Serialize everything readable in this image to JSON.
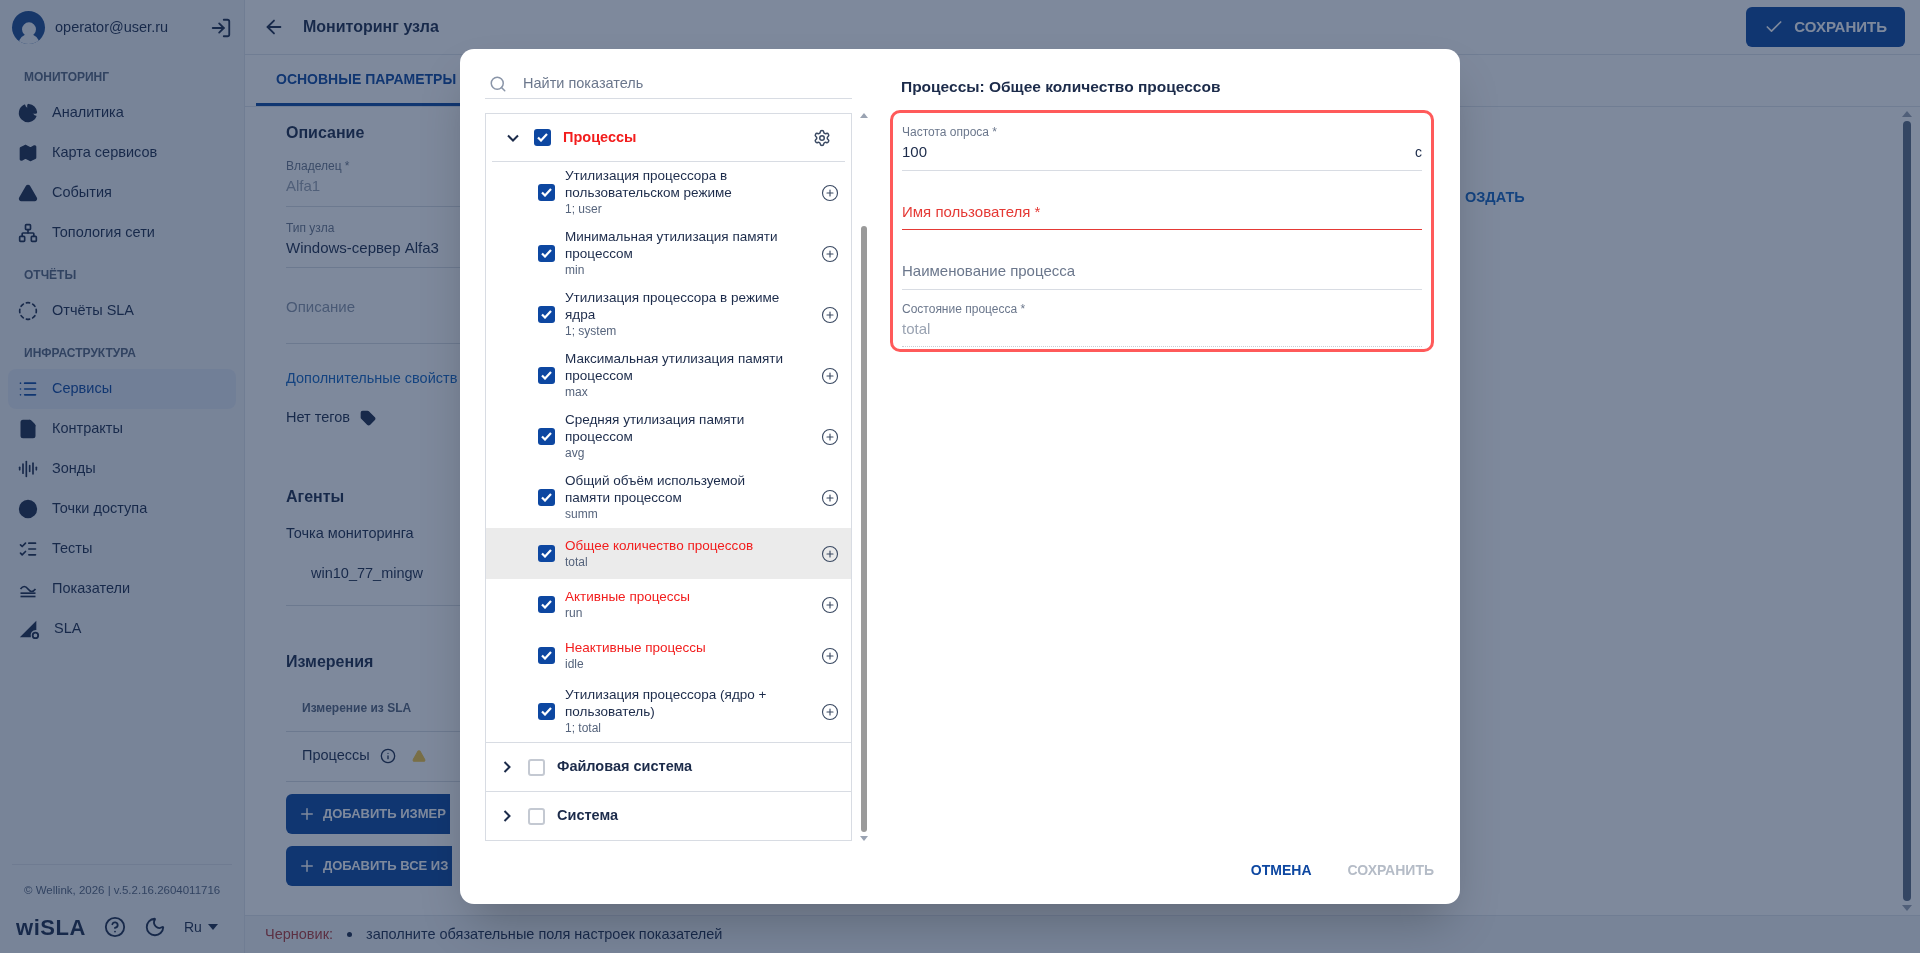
{
  "sidebar": {
    "user": "operator@user.ru",
    "sections": [
      {
        "title": "МОНИТОРИНГ",
        "items": [
          {
            "label": "Аналитика",
            "selected": false
          },
          {
            "label": "Карта сервисов",
            "selected": false
          },
          {
            "label": "События",
            "selected": false
          },
          {
            "label": "Топология сети",
            "selected": false
          }
        ]
      },
      {
        "title": "ОТЧЁТЫ",
        "items": [
          {
            "label": "Отчёты SLA",
            "selected": false
          }
        ]
      },
      {
        "title": "ИНФРАСТРУКТУРА",
        "items": [
          {
            "label": "Сервисы",
            "selected": true
          },
          {
            "label": "Контракты",
            "selected": false
          },
          {
            "label": "Зонды",
            "selected": false
          },
          {
            "label": "Точки доступа",
            "selected": false
          },
          {
            "label": "Тесты",
            "selected": false
          },
          {
            "label": "Показатели",
            "selected": false
          },
          {
            "label": "SLA",
            "selected": false
          }
        ]
      }
    ],
    "copyright": "© Wellink, 2026 | v.5.2.16.2604011716",
    "logo": "wiSLA",
    "language": "Ru"
  },
  "header": {
    "title": "Мониторинг узла",
    "save_button": "СОХРАНИТЬ"
  },
  "tabs": [
    {
      "label": "ОСНОВНЫЕ ПАРАМЕТРЫ",
      "selected": true
    }
  ],
  "description": {
    "heading": "Описание",
    "fields": [
      {
        "label": "Владелец *",
        "value": "Alfa1",
        "disabled": true
      },
      {
        "label": "Тип узла",
        "value": "Windows-сервер Alfa3",
        "disabled": false
      },
      {
        "placeholder": "Описание",
        "disabled": false
      }
    ],
    "more_link": "Дополнительные свойств",
    "tags": "Нет тегов"
  },
  "agents": {
    "heading": "Агенты",
    "label": "Точка мониторинга",
    "value": "win10_77_mingw"
  },
  "measurements": {
    "heading": "Измерения",
    "column_1": "Измерение из SLA",
    "rows": [
      {
        "name": "Процессы"
      }
    ],
    "buttons": [
      "ДОБАВИТЬ ИЗМЕР",
      "ДОБАВИТЬ ВСЕ ИЗ"
    ]
  },
  "side_action": "ОЗДАТЬ",
  "status_bar": {
    "label": "Черновик:",
    "messages": [
      "заполните обязательные поля настроек показателей"
    ]
  },
  "dialog": {
    "search": {
      "placeholder": "Найти показатель"
    },
    "groups": [
      {
        "label": "Процессы",
        "expanded": true,
        "checked": true,
        "invalid": true,
        "children": [
          {
            "label": "Утилизация процессора в пользовательском режиме",
            "code": "1; user",
            "checked": true,
            "invalid": false,
            "selected": false
          },
          {
            "label": "Минимальная утилизация памяти процессом",
            "code": "min",
            "checked": true,
            "invalid": false,
            "selected": false
          },
          {
            "label": "Утилизация процессора в режиме ядра",
            "code": "1; system",
            "checked": true,
            "invalid": false,
            "selected": false
          },
          {
            "label": "Максимальная утилизация памяти процессом",
            "code": "max",
            "checked": true,
            "invalid": false,
            "selected": false
          },
          {
            "label": "Средняя утилизация памяти процессом",
            "code": "avg",
            "checked": true,
            "invalid": false,
            "selected": false
          },
          {
            "label": "Общий объём используемой памяти процессом",
            "code": "summ",
            "checked": true,
            "invalid": false,
            "selected": false
          },
          {
            "label": "Общее количество процессов",
            "code": "total",
            "checked": true,
            "invalid": true,
            "selected": true
          },
          {
            "label": "Активные процессы",
            "code": "run",
            "checked": true,
            "invalid": true,
            "selected": false
          },
          {
            "label": "Неактивные процессы",
            "code": "idle",
            "checked": true,
            "invalid": true,
            "selected": false
          },
          {
            "label": "Утилизация процессора (ядро + пользователь)",
            "code": "1; total",
            "checked": true,
            "invalid": false,
            "selected": false
          }
        ]
      },
      {
        "label": "Файловая система",
        "expanded": false,
        "checked": false,
        "invalid": false
      },
      {
        "label": "Система",
        "expanded": false,
        "checked": false,
        "invalid": false
      }
    ],
    "detail": {
      "title": "Процессы: Общее количество процессов",
      "highlighted": true,
      "fields": [
        {
          "label": "Частота опроса *",
          "value": "100",
          "suffix": "с",
          "error": false,
          "disabled": false
        },
        {
          "placeholder": "Имя пользователя *",
          "error": true,
          "disabled": false
        },
        {
          "placeholder": "Наименование процесса",
          "error": false,
          "disabled": false
        },
        {
          "label": "Состояние процесса *",
          "value": "total",
          "error": false,
          "disabled": true
        }
      ]
    },
    "buttons": [
      {
        "label": "ОТМЕНА",
        "disabled": false
      },
      {
        "label": "СОХРАНИТЬ",
        "disabled": true
      }
    ]
  }
}
